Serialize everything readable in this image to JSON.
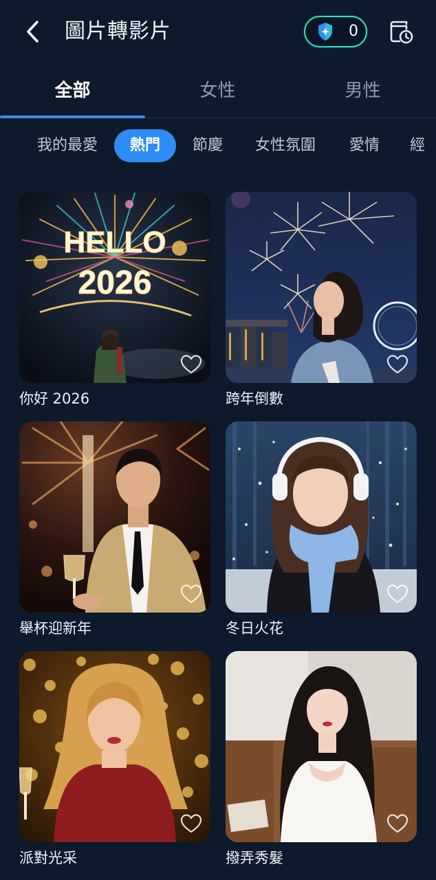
{
  "header": {
    "back_icon": "chevron-left-icon",
    "title": "圖片轉影片",
    "credits": "0",
    "credit_icon": "shield-sparkle-icon",
    "history_icon": "history-clock-icon"
  },
  "tabs": [
    {
      "label": "全部",
      "active": true
    },
    {
      "label": "女性",
      "active": false
    },
    {
      "label": "男性",
      "active": false
    }
  ],
  "chips": [
    {
      "label": "我的最愛",
      "active": false
    },
    {
      "label": "熱門",
      "active": true
    },
    {
      "label": "節慶",
      "active": false
    },
    {
      "label": "女性氛圍",
      "active": false
    },
    {
      "label": "愛情",
      "active": false
    },
    {
      "label": "經",
      "active": false
    }
  ],
  "templates": [
    {
      "title": "你好 2026",
      "favorite": false,
      "image_text": [
        "HELLO",
        "2026"
      ]
    },
    {
      "title": "跨年倒數",
      "favorite": false
    },
    {
      "title": "舉杯迎新年",
      "favorite": false
    },
    {
      "title": "冬日火花",
      "favorite": false
    },
    {
      "title": "派對光采",
      "favorite": false
    },
    {
      "title": "撥弄秀髮",
      "favorite": false
    }
  ],
  "colors": {
    "background": "#0c1a2b",
    "accent": "#2f8cf5",
    "credit_border": "#2fe0c6",
    "inactive_text": "#8e9bab"
  }
}
